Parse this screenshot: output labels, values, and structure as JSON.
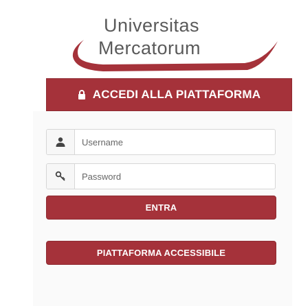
{
  "logo": {
    "line1": "Universitas",
    "line2": "Mercatorum"
  },
  "header": {
    "title": "ACCEDI ALLA PIATTAFORMA",
    "icon": "lock-icon"
  },
  "login_form": {
    "username": {
      "placeholder": "Username",
      "value": "",
      "icon": "user-icon"
    },
    "password": {
      "placeholder": "Password",
      "value": "",
      "icon": "key-icon"
    },
    "submit_label": "ENTRA",
    "accessible_label": "PIATTAFORMA ACCESSIBILE"
  },
  "colors": {
    "brand": "#a5323a",
    "logo_text": "#5a5a5a"
  }
}
